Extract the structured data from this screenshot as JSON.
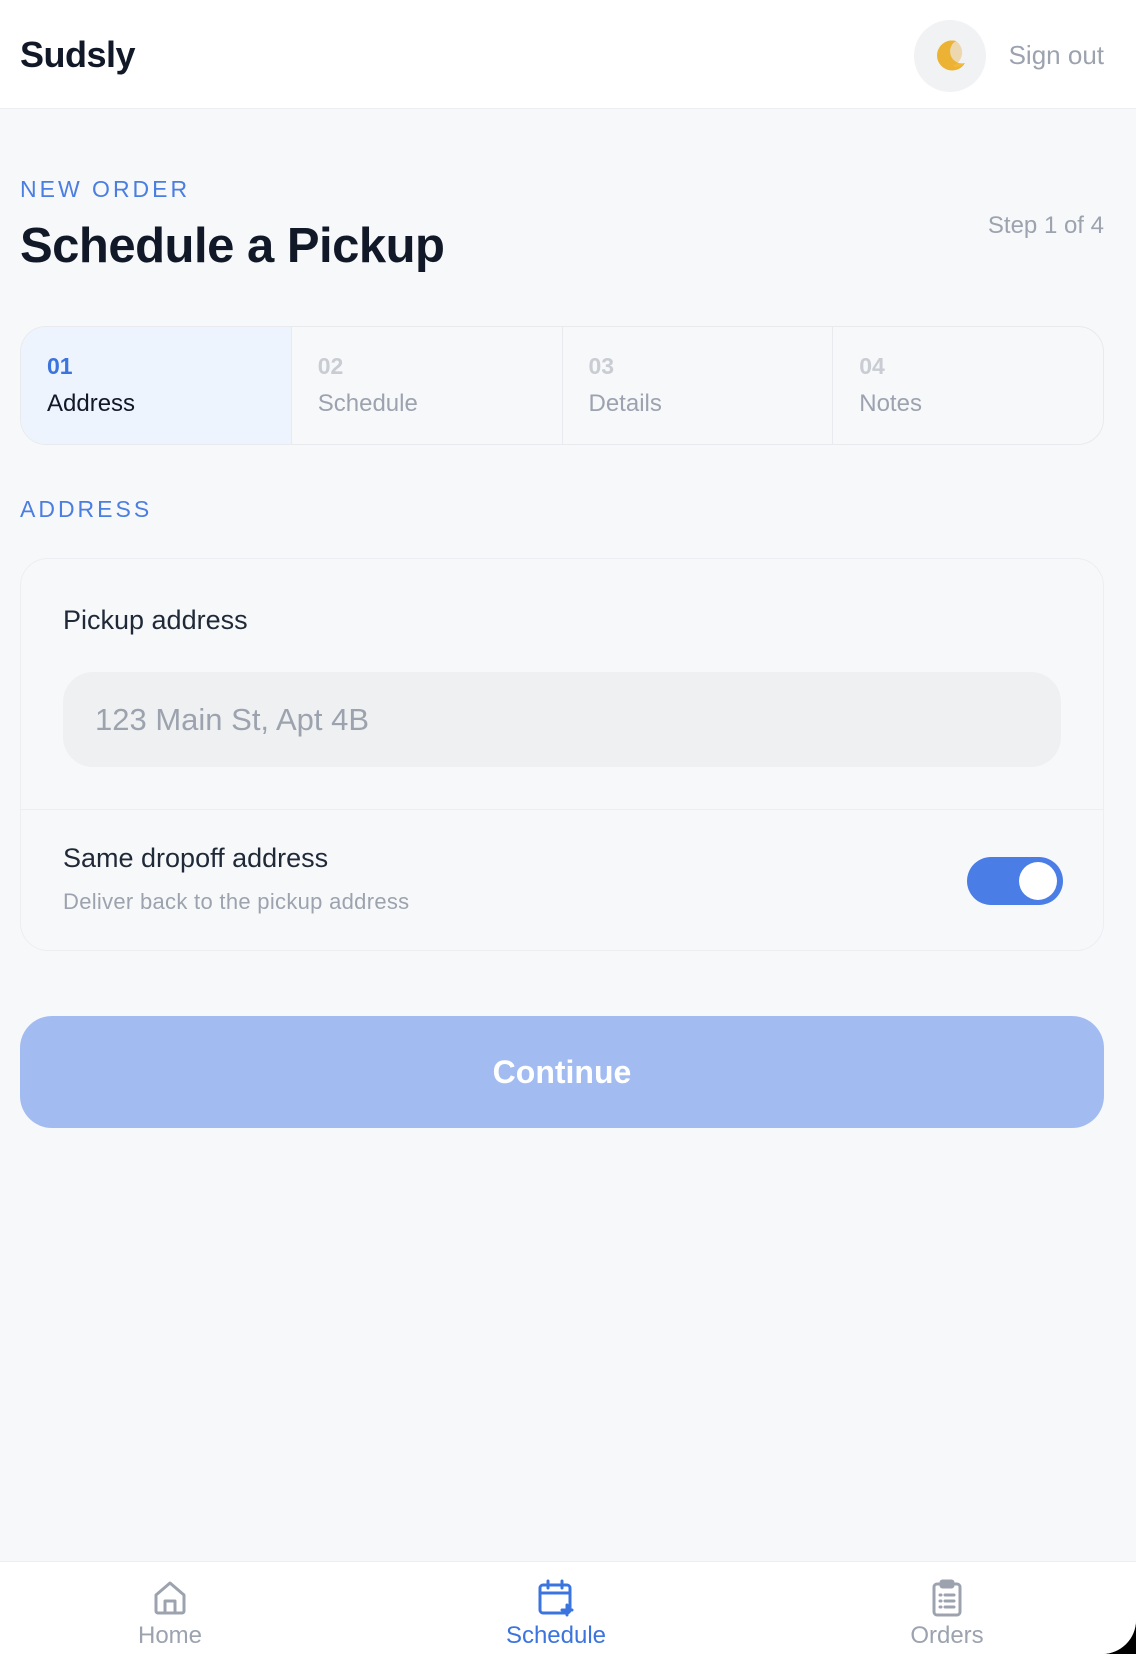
{
  "header": {
    "brand": "Sudsly",
    "theme_icon": "moon-icon",
    "sign_out_label": "Sign out"
  },
  "intro": {
    "eyebrow": "NEW ORDER",
    "title": "Schedule a Pickup",
    "step_indicator": "Step 1 of 4"
  },
  "stepper": {
    "steps": [
      {
        "num": "01",
        "label": "Address",
        "active": true
      },
      {
        "num": "02",
        "label": "Schedule",
        "active": false
      },
      {
        "num": "03",
        "label": "Details",
        "active": false
      },
      {
        "num": "04",
        "label": "Notes",
        "active": false
      }
    ]
  },
  "section": {
    "label": "ADDRESS"
  },
  "form": {
    "pickup_label": "Pickup address",
    "pickup_value": "",
    "pickup_placeholder": "123 Main St, Apt 4B",
    "same_dropoff_title": "Same dropoff address",
    "same_dropoff_subtitle": "Deliver back to the pickup address",
    "same_dropoff_enabled": true
  },
  "continue_label": "Continue",
  "colors": {
    "accent": "#3b74df",
    "toggle_on": "#4a7ee6",
    "continue_disabled": "#a2bcf2"
  },
  "bottom_nav": {
    "items": [
      {
        "label": "Home",
        "icon": "home-icon",
        "active": false
      },
      {
        "label": "Schedule",
        "icon": "calendar-plus-icon",
        "active": true
      },
      {
        "label": "Orders",
        "icon": "clipboard-list-icon",
        "active": false
      }
    ]
  }
}
